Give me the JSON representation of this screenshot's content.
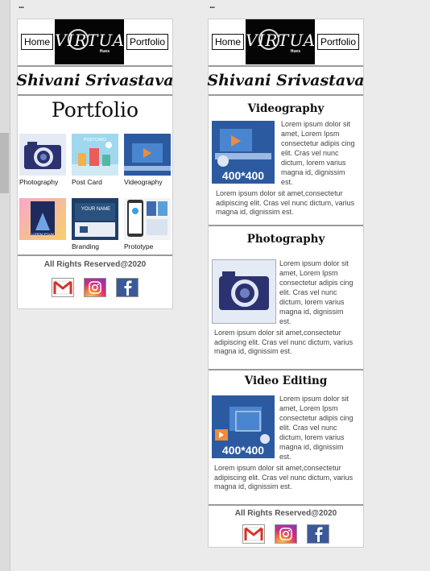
{
  "nav": {
    "home_label": "Home",
    "portfolio_label": "Portfolio"
  },
  "logo": {
    "text": "VIRTUAL",
    "subtext": "Hues"
  },
  "owner_name": "Shivani Srivastava",
  "left_board": {
    "dots": "...",
    "title": "Portfolio",
    "tiles": [
      {
        "label": "Photography"
      },
      {
        "label": "Post Card"
      },
      {
        "label": "Videography"
      },
      {
        "label": ""
      },
      {
        "label": "Branding"
      },
      {
        "label": "Prototype"
      }
    ],
    "footer": "All Rights Reserved@2020"
  },
  "right_board": {
    "dots": "...",
    "sections": [
      {
        "title": "Videography",
        "image_label": "400*400",
        "side_text": "Lorem ipsum dolor sit amet, Lorem Ipsm consectetur adipis cing elit. Cras vel  nunc dictum, lorem varius magna id,  dignissim est.",
        "bottom_text": "Lorem ipsum dolor sit amet,consectetur adipiscing elit. Cras vel nunc dictum, varius magna id, dignissim est."
      },
      {
        "title": "Photography",
        "image_label": "",
        "side_text": "Lorem ipsum dolor sit amet, Lorem Ipsm consectetur adipis cing elit. Cras vel  nunc dictum, lorem varius magna id,  dignissim est.",
        "bottom_text": "Lorem ipsum dolor sit amet,consectetur adipiscing elit. Cras vel nunc dictum, varius magna id, dignissim est."
      },
      {
        "title": "Video Editing",
        "image_label": "400*400",
        "side_text": "Lorem ipsum dolor sit amet, Lorem Ipsm consectetur adipis cing elit. Cras vel  nunc dictum, lorem varius magna id,  dignissim est.",
        "bottom_text": "Lorem ipsum dolor sit amet,consectetur adipiscing elit. Cras vel nunc dictum, varius magna id, dignissim est."
      }
    ],
    "footer": "All Rights Reserved@2020"
  },
  "tile_texts": {
    "postcard_heading": "POSTCARD",
    "business_card_name": "YOUR NAME",
    "poster_caption": "LOREM IPSUM"
  },
  "social": [
    "gmail-icon",
    "instagram-icon",
    "facebook-icon"
  ],
  "colors": {
    "divider": "#9a9a9a",
    "logo_bg": "#050505",
    "media_blue": "#2c5aa0"
  }
}
